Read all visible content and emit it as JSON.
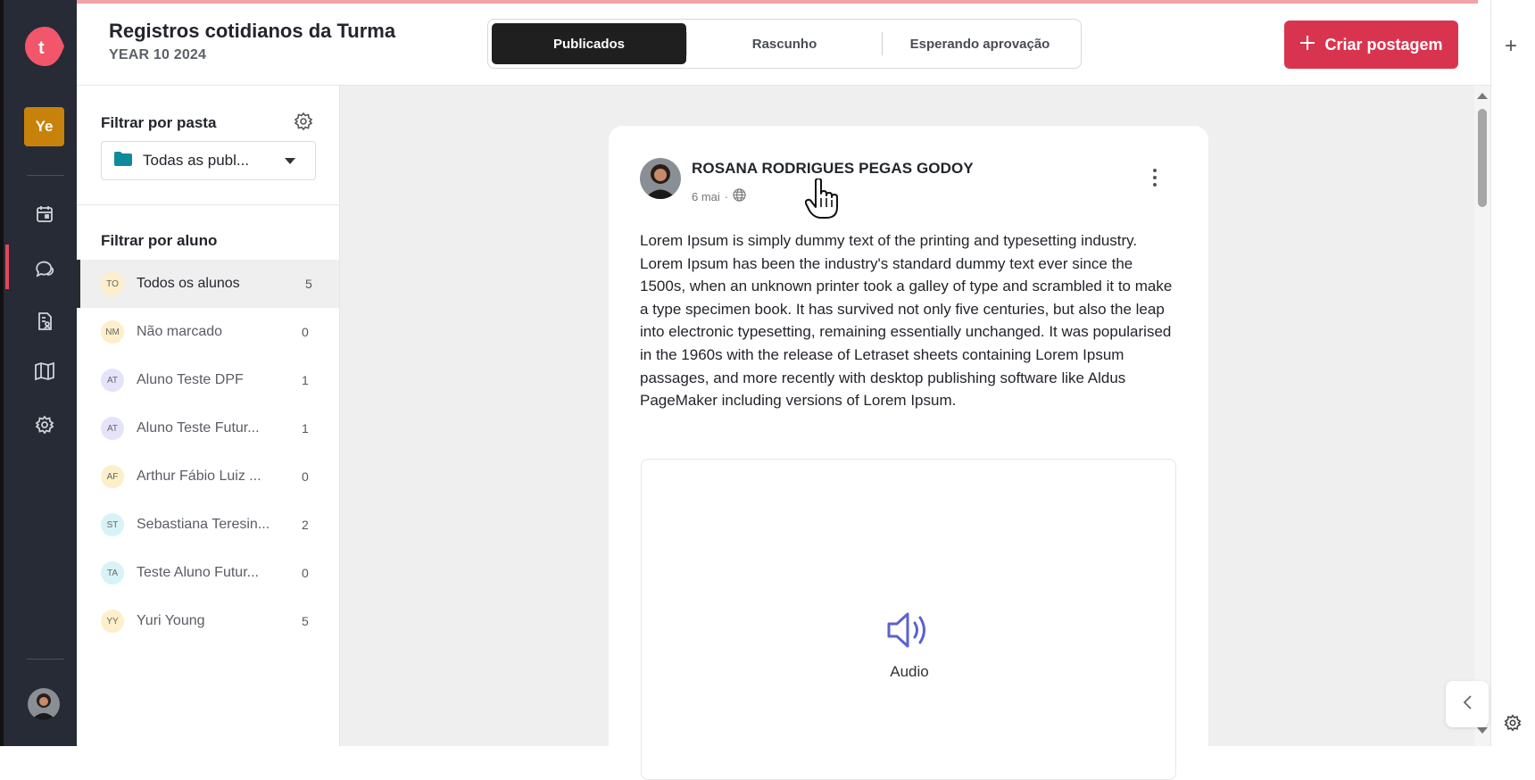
{
  "app": {
    "logo_letter": "t",
    "brand_color": "#e2475d",
    "workspace_badge": "Ye"
  },
  "header": {
    "title": "Registros cotidianos da Turma",
    "subtitle": "YEAR 10 2024",
    "tabs": [
      {
        "label": "Publicados",
        "active": true
      },
      {
        "label": "Rascunho",
        "active": false
      },
      {
        "label": "Esperando aprovação",
        "active": false
      }
    ],
    "create_button": "Criar postagem"
  },
  "sidebar_nav": [
    "calendar-icon",
    "chat-icon",
    "report-icon",
    "book-icon",
    "gear-icon"
  ],
  "filter": {
    "folder_title": "Filtrar por pasta",
    "folder_value": "Todas as publ...",
    "student_title": "Filtrar por aluno",
    "students": [
      {
        "initials": "TO",
        "name": "Todos os alunos",
        "count": "5",
        "color": "#fdefc9"
      },
      {
        "initials": "NM",
        "name": "Não marcado",
        "count": "0",
        "color": "#fdefc9"
      },
      {
        "initials": "AT",
        "name": "Aluno Teste DPF",
        "count": "1",
        "color": "#e4e3fa"
      },
      {
        "initials": "AT",
        "name": "Aluno Teste Futur...",
        "count": "1",
        "color": "#e4e3fa"
      },
      {
        "initials": "AF",
        "name": "Arthur Fábio Luiz ...",
        "count": "0",
        "color": "#fdefc9"
      },
      {
        "initials": "ST",
        "name": "Sebastiana Teresin...",
        "count": "2",
        "color": "#d8f3f6"
      },
      {
        "initials": "TA",
        "name": "Teste Aluno Futur...",
        "count": "0",
        "color": "#d8f3f6"
      },
      {
        "initials": "YY",
        "name": "Yuri Young",
        "count": "5",
        "color": "#fdefc9"
      }
    ]
  },
  "post": {
    "author": "ROSANA RODRIGUES PEGAS GODOY",
    "date": "6 mai",
    "separator": "·",
    "body": "Lorem Ipsum is simply dummy text of the printing and typesetting industry. Lorem Ipsum has been the industry's standard dummy text ever since the 1500s, when an unknown printer took a galley of type and scrambled it to make a type specimen book. It has survived not only five centuries, but also the leap into electronic typesetting, remaining essentially unchanged. It was popularised in the 1960s with the release of Letraset sheets containing Lorem Ipsum passages, and more recently with desktop publishing software like Aldus PageMaker including versions of Lorem Ipsum.",
    "attachment_label": "Audio"
  }
}
